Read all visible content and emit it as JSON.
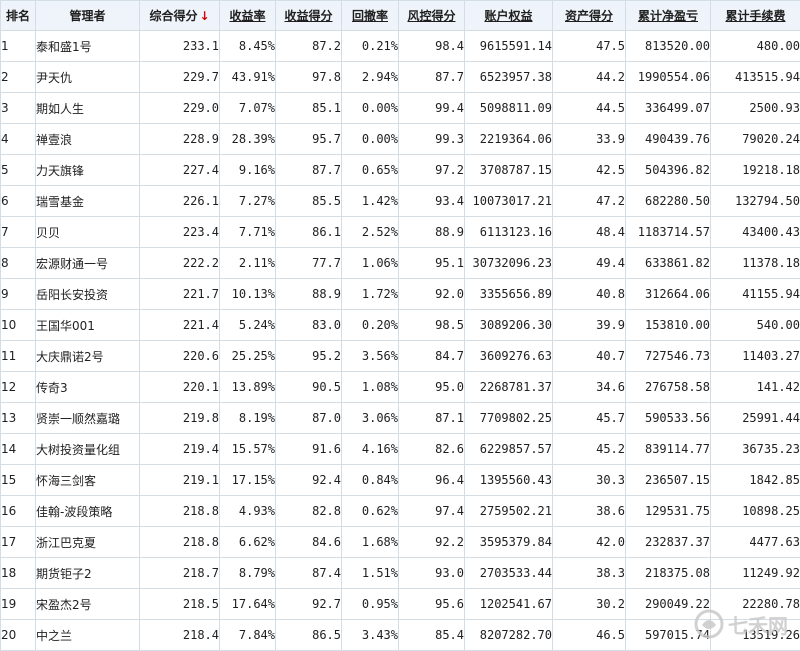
{
  "columns": {
    "rank": "排名",
    "manager": "管理者",
    "score": "综合得分",
    "sort_arrow": "↓",
    "return_rate": "收益率",
    "return_score": "收益得分",
    "drawdown": "回撤率",
    "risk_score": "风控得分",
    "equity": "账户权益",
    "asset_score": "资产得分",
    "net_profit": "累计净盈亏",
    "fees": "累计手续费"
  },
  "colors": {
    "header_link": "#1a3a9c",
    "profit": "#cc0000",
    "sort_arrow": "#d40000",
    "border": "#d3dde6"
  },
  "rows": [
    {
      "rank": "1",
      "manager": "泰和盛1号",
      "score": "233.1",
      "return_rate": "8.45%",
      "return_score": "87.2",
      "drawdown": "0.21%",
      "risk_score": "98.4",
      "equity": "9615591.14",
      "asset_score": "47.5",
      "net_profit": "813520.00",
      "fees": "480.00"
    },
    {
      "rank": "2",
      "manager": "尹天仇",
      "score": "229.7",
      "return_rate": "43.91%",
      "return_score": "97.8",
      "drawdown": "2.94%",
      "risk_score": "87.7",
      "equity": "6523957.38",
      "asset_score": "44.2",
      "net_profit": "1990554.06",
      "fees": "413515.94"
    },
    {
      "rank": "3",
      "manager": "期如人生",
      "score": "229.0",
      "return_rate": "7.07%",
      "return_score": "85.1",
      "drawdown": "0.00%",
      "risk_score": "99.4",
      "equity": "5098811.09",
      "asset_score": "44.5",
      "net_profit": "336499.07",
      "fees": "2500.93"
    },
    {
      "rank": "4",
      "manager": "禅壹浪",
      "score": "228.9",
      "return_rate": "28.39%",
      "return_score": "95.7",
      "drawdown": "0.00%",
      "risk_score": "99.3",
      "equity": "2219364.06",
      "asset_score": "33.9",
      "net_profit": "490439.76",
      "fees": "79020.24"
    },
    {
      "rank": "5",
      "manager": "力天旗锋",
      "score": "227.4",
      "return_rate": "9.16%",
      "return_score": "87.7",
      "drawdown": "0.65%",
      "risk_score": "97.2",
      "equity": "3708787.15",
      "asset_score": "42.5",
      "net_profit": "504396.82",
      "fees": "19218.18"
    },
    {
      "rank": "6",
      "manager": "瑞雪基金",
      "score": "226.1",
      "return_rate": "7.27%",
      "return_score": "85.5",
      "drawdown": "1.42%",
      "risk_score": "93.4",
      "equity": "10073017.21",
      "asset_score": "47.2",
      "net_profit": "682280.50",
      "fees": "132794.50"
    },
    {
      "rank": "7",
      "manager": "贝贝",
      "score": "223.4",
      "return_rate": "7.71%",
      "return_score": "86.1",
      "drawdown": "2.52%",
      "risk_score": "88.9",
      "equity": "6113123.16",
      "asset_score": "48.4",
      "net_profit": "1183714.57",
      "fees": "43400.43"
    },
    {
      "rank": "8",
      "manager": "宏源财通一号",
      "score": "222.2",
      "return_rate": "2.11%",
      "return_score": "77.7",
      "drawdown": "1.06%",
      "risk_score": "95.1",
      "equity": "30732096.23",
      "asset_score": "49.4",
      "net_profit": "633861.82",
      "fees": "11378.18"
    },
    {
      "rank": "9",
      "manager": "岳阳长安投资",
      "score": "221.7",
      "return_rate": "10.13%",
      "return_score": "88.9",
      "drawdown": "1.72%",
      "risk_score": "92.0",
      "equity": "3355656.89",
      "asset_score": "40.8",
      "net_profit": "312664.06",
      "fees": "41155.94"
    },
    {
      "rank": "10",
      "manager": "王国华001",
      "score": "221.4",
      "return_rate": "5.24%",
      "return_score": "83.0",
      "drawdown": "0.20%",
      "risk_score": "98.5",
      "equity": "3089206.30",
      "asset_score": "39.9",
      "net_profit": "153810.00",
      "fees": "540.00"
    },
    {
      "rank": "11",
      "manager": "大庆鼎诺2号",
      "score": "220.6",
      "return_rate": "25.25%",
      "return_score": "95.2",
      "drawdown": "3.56%",
      "risk_score": "84.7",
      "equity": "3609276.63",
      "asset_score": "40.7",
      "net_profit": "727546.73",
      "fees": "11403.27"
    },
    {
      "rank": "12",
      "manager": "传奇3",
      "score": "220.1",
      "return_rate": "13.89%",
      "return_score": "90.5",
      "drawdown": "1.08%",
      "risk_score": "95.0",
      "equity": "2268781.37",
      "asset_score": "34.6",
      "net_profit": "276758.58",
      "fees": "141.42"
    },
    {
      "rank": "13",
      "manager": "贤崇一顺然嘉璐",
      "score": "219.8",
      "return_rate": "8.19%",
      "return_score": "87.0",
      "drawdown": "3.06%",
      "risk_score": "87.1",
      "equity": "7709802.25",
      "asset_score": "45.7",
      "net_profit": "590533.56",
      "fees": "25991.44"
    },
    {
      "rank": "14",
      "manager": "大树投资量化组",
      "score": "219.4",
      "return_rate": "15.57%",
      "return_score": "91.6",
      "drawdown": "4.16%",
      "risk_score": "82.6",
      "equity": "6229857.57",
      "asset_score": "45.2",
      "net_profit": "839114.77",
      "fees": "36735.23"
    },
    {
      "rank": "15",
      "manager": "怀海三剑客",
      "score": "219.1",
      "return_rate": "17.15%",
      "return_score": "92.4",
      "drawdown": "0.84%",
      "risk_score": "96.4",
      "equity": "1395560.43",
      "asset_score": "30.3",
      "net_profit": "236507.15",
      "fees": "1842.85"
    },
    {
      "rank": "16",
      "manager": "佳翰-波段策略",
      "score": "218.8",
      "return_rate": "4.93%",
      "return_score": "82.8",
      "drawdown": "0.62%",
      "risk_score": "97.4",
      "equity": "2759502.21",
      "asset_score": "38.6",
      "net_profit": "129531.75",
      "fees": "10898.25"
    },
    {
      "rank": "17",
      "manager": "浙江巴克夏",
      "score": "218.8",
      "return_rate": "6.62%",
      "return_score": "84.6",
      "drawdown": "1.68%",
      "risk_score": "92.2",
      "equity": "3595379.84",
      "asset_score": "42.0",
      "net_profit": "232837.37",
      "fees": "4477.63"
    },
    {
      "rank": "18",
      "manager": "期货钜子2",
      "score": "218.7",
      "return_rate": "8.79%",
      "return_score": "87.4",
      "drawdown": "1.51%",
      "risk_score": "93.0",
      "equity": "2703533.44",
      "asset_score": "38.3",
      "net_profit": "218375.08",
      "fees": "11249.92"
    },
    {
      "rank": "19",
      "manager": "宋盈杰2号",
      "score": "218.5",
      "return_rate": "17.64%",
      "return_score": "92.7",
      "drawdown": "0.95%",
      "risk_score": "95.6",
      "equity": "1202541.67",
      "asset_score": "30.2",
      "net_profit": "290049.22",
      "fees": "22280.78"
    },
    {
      "rank": "20",
      "manager": "中之兰",
      "score": "218.4",
      "return_rate": "7.84%",
      "return_score": "86.5",
      "drawdown": "3.43%",
      "risk_score": "85.4",
      "equity": "8207282.70",
      "asset_score": "46.5",
      "net_profit": "597015.74",
      "fees": "13519.26"
    }
  ],
  "watermark": {
    "text": "七禾网",
    "icon": "qihe-logo-icon"
  }
}
